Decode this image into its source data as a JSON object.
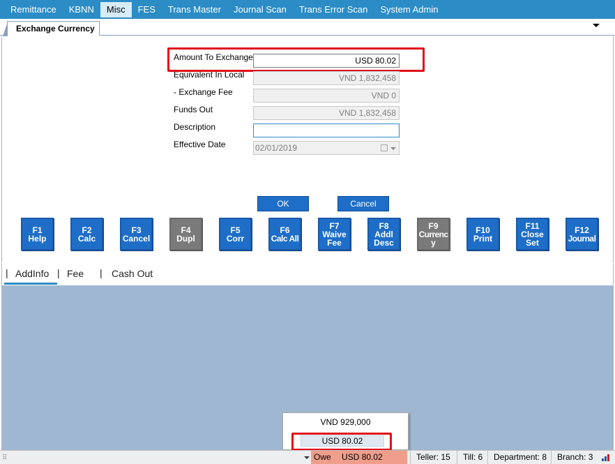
{
  "menu": {
    "items": [
      {
        "label": "Remittance"
      },
      {
        "label": "KBNN"
      },
      {
        "label": "Misc"
      },
      {
        "label": "FES"
      },
      {
        "label": "Trans Master"
      },
      {
        "label": "Journal Scan"
      },
      {
        "label": "Trans Error Scan"
      },
      {
        "label": "System Admin"
      }
    ]
  },
  "tab": {
    "title": "Exchange Currency"
  },
  "form": {
    "amount": {
      "label": "Amount To Exchange",
      "value": "USD 80.02"
    },
    "equivalent": {
      "label": "Equivalent In Local",
      "value": "VND 1,832,458"
    },
    "fee": {
      "label": "- Exchange Fee",
      "value": "VND 0"
    },
    "funds_out": {
      "label": "Funds Out",
      "value": "VND 1,832,458"
    },
    "description": {
      "label": "Description",
      "value": ""
    },
    "effective_date": {
      "label": "Effective Date",
      "value": "02/01/2019"
    }
  },
  "buttons": {
    "ok": "OK",
    "cancel": "Cancel"
  },
  "fkeys": [
    {
      "key": "F1",
      "line1": "Help",
      "line2": ""
    },
    {
      "key": "F2",
      "line1": "Calc",
      "line2": ""
    },
    {
      "key": "F3",
      "line1": "Cancel",
      "line2": ""
    },
    {
      "key": "F4",
      "line1": "Dupl",
      "line2": ""
    },
    {
      "key": "F5",
      "line1": "Corr",
      "line2": ""
    },
    {
      "key": "F6",
      "line1": "Calc All",
      "line2": ""
    },
    {
      "key": "F7",
      "line1": "Waive",
      "line2": "Fee"
    },
    {
      "key": "F8",
      "line1": "Addl",
      "line2": "Desc"
    },
    {
      "key": "F9",
      "line1": "Currenc",
      "line2": "y"
    },
    {
      "key": "F10",
      "line1": "Print",
      "line2": ""
    },
    {
      "key": "F11",
      "line1": "Close",
      "line2": "Set"
    },
    {
      "key": "F12",
      "line1": "Journal",
      "line2": ""
    }
  ],
  "bottom_tabs": {
    "sep": "|",
    "addinfo": "AddInfo",
    "fee": "Fee",
    "cashout": "Cash Out"
  },
  "popup": {
    "item1": "VND 929,000",
    "item2": "USD 80.02"
  },
  "status": {
    "owe_label": "Owe",
    "owe_value": "USD 80.02",
    "teller": "Teller: 15",
    "till": "Till: 6",
    "department": "Department: 8",
    "branch": "Branch: 3"
  },
  "colors": {
    "menu_bg": "#2b8cc6",
    "fkey_bg": "#1e6ec8",
    "panel_bg": "#9fb7d1",
    "highlight": "#e0101a",
    "owe_bg": "#ee9e8a"
  }
}
